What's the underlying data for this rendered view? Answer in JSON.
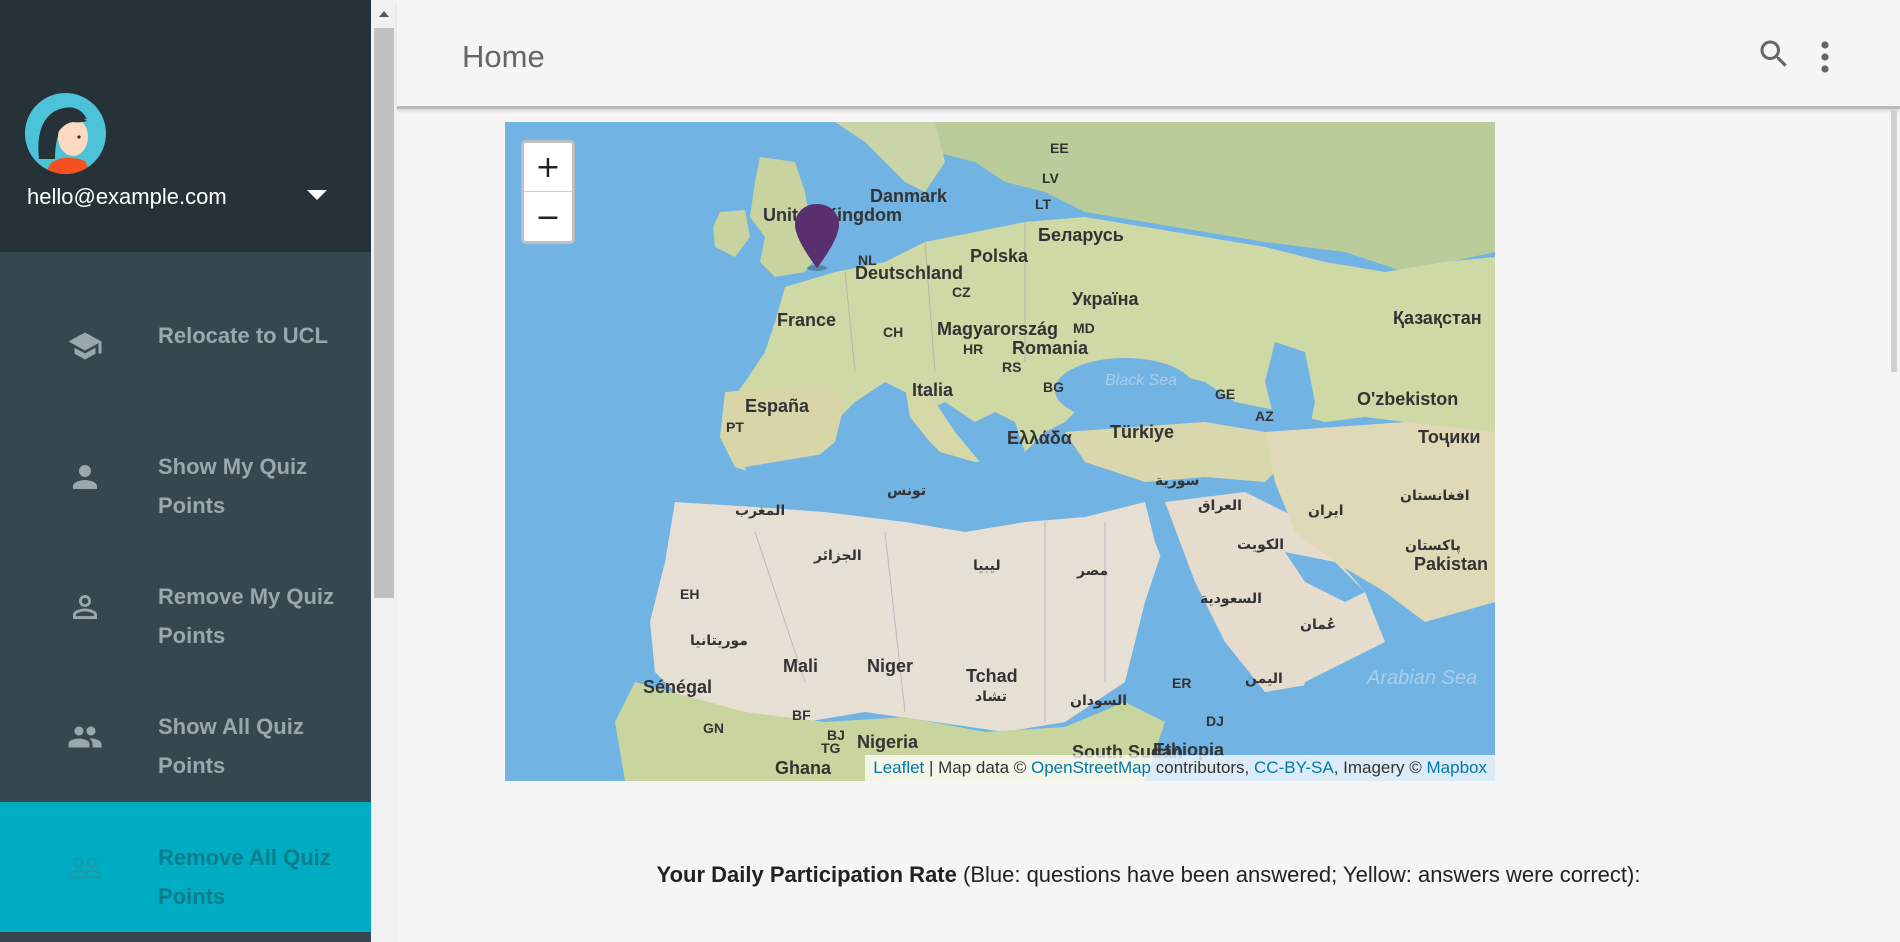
{
  "account": {
    "email": "hello@example.com"
  },
  "nav": {
    "items": [
      {
        "label": "Relocate to UCL",
        "icon": "school-icon"
      },
      {
        "label": "Show My Quiz Points",
        "icon": "person-icon"
      },
      {
        "label": "Remove My Quiz Points",
        "icon": "person-outline-icon"
      },
      {
        "label": "Show All Quiz Points",
        "icon": "people-icon"
      },
      {
        "label": "Remove All Quiz Points",
        "icon": "people-outline-icon",
        "active": true
      }
    ]
  },
  "header": {
    "title": "Home"
  },
  "map": {
    "zoom_in": "+",
    "zoom_out": "−",
    "labels": {
      "uk": "United Kingdom",
      "danmark": "Danmark",
      "ee": "EE",
      "lv": "LV",
      "lt": "LT",
      "belarus": "Беларусь",
      "polska": "Polska",
      "nl": "NL",
      "deutschland": "Deutschland",
      "cz": "CZ",
      "ukraina": "Україна",
      "france": "France",
      "ch": "CH",
      "magyar": "Magyarország",
      "md": "MD",
      "romania": "Romania",
      "hr": "HR",
      "rs": "RS",
      "bg": "BG",
      "kazakhstan": "Қазақстан",
      "espana": "España",
      "pt": "PT",
      "italia": "Italia",
      "black_sea": "Black Sea",
      "ge": "GE",
      "az": "AZ",
      "uzbekiston": "O'zbekiston",
      "turkiye": "Türkiye",
      "ellada": "Ελλάδα",
      "tojiki": "Тоҷики",
      "tunis": "تونس",
      "maghrib": "المغرب",
      "suriya": "سورية",
      "iraq": "العراق",
      "iran": "ایران",
      "afghan": "افغانستان",
      "jazair": "الجزائر",
      "libya": "ليبيا",
      "misr": "مصر",
      "kuwait": "الكويت",
      "pakistan_ar": "پاکستان",
      "pakistan": "Pakistan",
      "eh": "EH",
      "saudi": "السعودية",
      "oman": "عُمان",
      "mauritania": "موريتانيا",
      "mali": "Mali",
      "niger": "Niger",
      "tchad": "Tchad",
      "tchad_ar": "تشاد",
      "senegal": "Sénégal",
      "er": "ER",
      "yemen": "اليمن",
      "arabian_sea": "Arabian Sea",
      "sudan": "السودان",
      "gn": "GN",
      "bf": "BF",
      "bj": "BJ",
      "tg": "TG",
      "nigeria": "Nigeria",
      "dj": "DJ",
      "ethiopia": "Ethiopia",
      "ghana": "Ghana",
      "south_sudan": "South Sudan"
    },
    "attribution": {
      "leaflet": "Leaflet",
      "sep": " | Map data © ",
      "osm": "OpenStreetMap",
      "contributors": " contributors, ",
      "license": "CC-BY-SA",
      "imagery": ", Imagery © ",
      "mapbox": "Mapbox"
    }
  },
  "caption": {
    "bold": "Your Daily Participation Rate",
    "rest": " (Blue: questions have been answered; Yellow: answers were correct):"
  },
  "colors": {
    "sidebar_bg": "#37474f",
    "sidebar_header_bg": "#263238",
    "active_item": "#00acc1",
    "marker": "#5a2f6e"
  }
}
